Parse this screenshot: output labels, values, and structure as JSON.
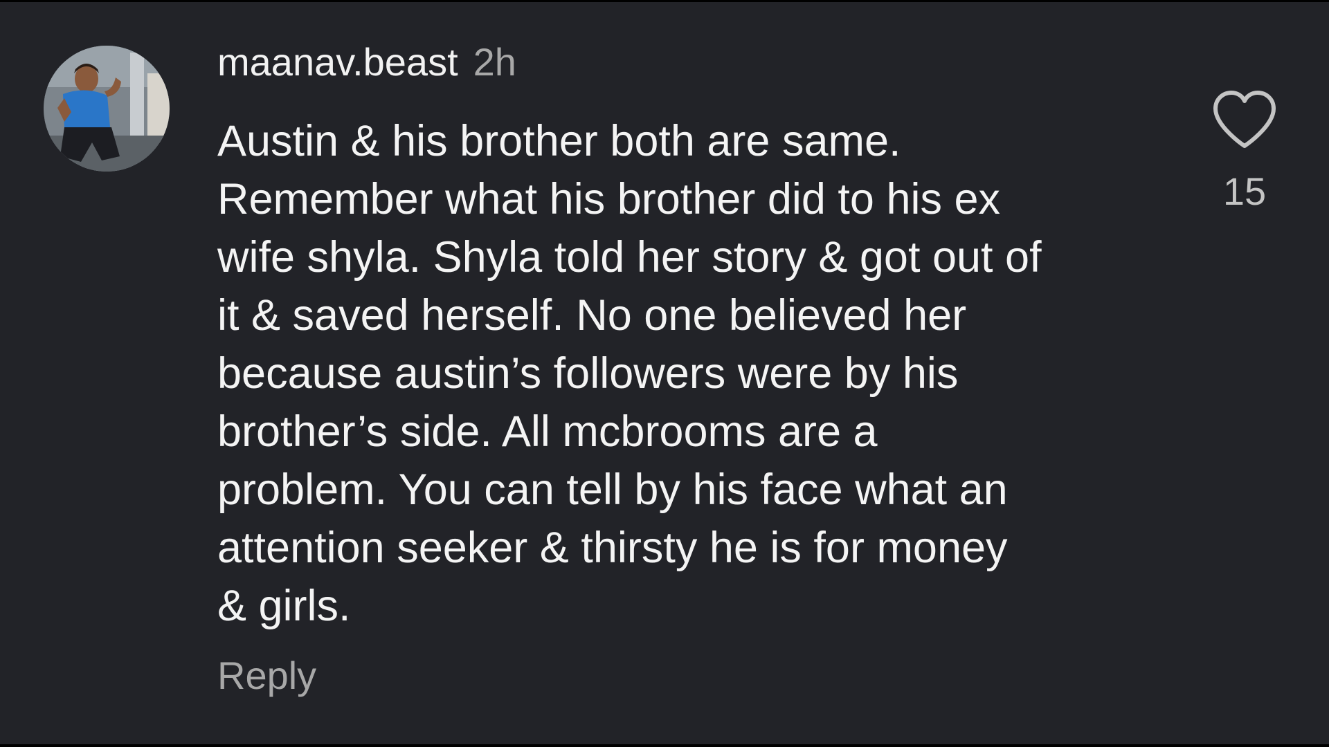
{
  "comment": {
    "username": "maanav.beast",
    "timestamp": "2h",
    "text": "Austin & his brother both are same.\nRemember what his brother did to his ex\nwife shyla. Shyla told her story & got out of\nit & saved herself. No one believed her\nbecause austin’s followers were by his\nbrother’s side. All mcbrooms are a\nproblem. You can tell by his face what an\nattention seeker & thirsty he is for money\n& girls.",
    "reply_label": "Reply",
    "like_count": "15",
    "like_icon": "heart-outline-icon",
    "avatar_icon": "user-avatar"
  },
  "colors": {
    "background": "#222328",
    "text_primary": "#f4f4f4",
    "text_secondary": "#a8a8a8"
  }
}
